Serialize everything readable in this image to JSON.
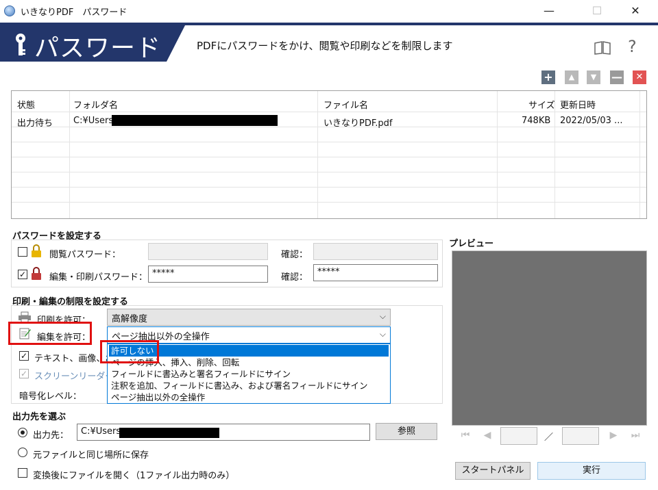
{
  "window": {
    "title": "いきなりPDF　パスワード",
    "minimize": "—",
    "maximize": "☐",
    "close": "✕"
  },
  "banner": {
    "title": "パスワード",
    "description": "PDFにパスワードをかけ、閲覧や印刷などを制限します",
    "help": "?"
  },
  "toolbar": {
    "add": "+",
    "up": "▲",
    "down": "▼",
    "remove": "—",
    "clear": "✕"
  },
  "file_list": {
    "columns": [
      "状態",
      "フォルダ名",
      "ファイル名",
      "サイズ",
      "更新日時"
    ],
    "rows": [
      {
        "status": "出力待ち",
        "folder": "C:¥Users",
        "file": "いきなりPDF.pdf",
        "size": "748KB",
        "modified": "2022/05/03 ..."
      }
    ]
  },
  "password_section": {
    "title": "パスワードを設定する",
    "view_label": "閲覧パスワード：",
    "view_checked": false,
    "view_confirm_label": "確認：",
    "edit_label": "編集・印刷パスワード：",
    "edit_checked": true,
    "edit_value": "*****",
    "edit_confirm_label": "確認：",
    "edit_confirm_value": "*****"
  },
  "restrict_section": {
    "title": "印刷・編集の制限を設定する",
    "print_label": "印刷を許可：",
    "print_value": "高解像度",
    "edit_label": "編集を許可：",
    "edit_value": "ページ抽出以外の全操作",
    "text_copy_label": "テキスト、画像、お",
    "screen_reader_label": "スクリーンリーダーデバ",
    "encrypt_label": "暗号化レベル：",
    "dropdown_options": [
      "許可しない",
      "ページの挿入、挿入、削除、回転",
      "フィールドに書込みと署名フィールドにサイン",
      "注釈を追加、フィールドに書込み、および署名フィールドにサイン",
      "ページ抽出以外の全操作"
    ]
  },
  "output_section": {
    "title": "出力先を選ぶ",
    "dest_label": "出力先：",
    "dest_value": "C:¥Users",
    "browse": "参照",
    "same_folder_label": "元ファイルと同じ場所に保存",
    "open_after_label": "変換後にファイルを開く（1ファイル出力時のみ）"
  },
  "preview": {
    "title": "プレビュー",
    "separator": "／",
    "first": "⏮",
    "prev": "◀",
    "next": "▶",
    "last": "⏭"
  },
  "buttons": {
    "start_panel": "スタートパネル",
    "run": "実行"
  }
}
